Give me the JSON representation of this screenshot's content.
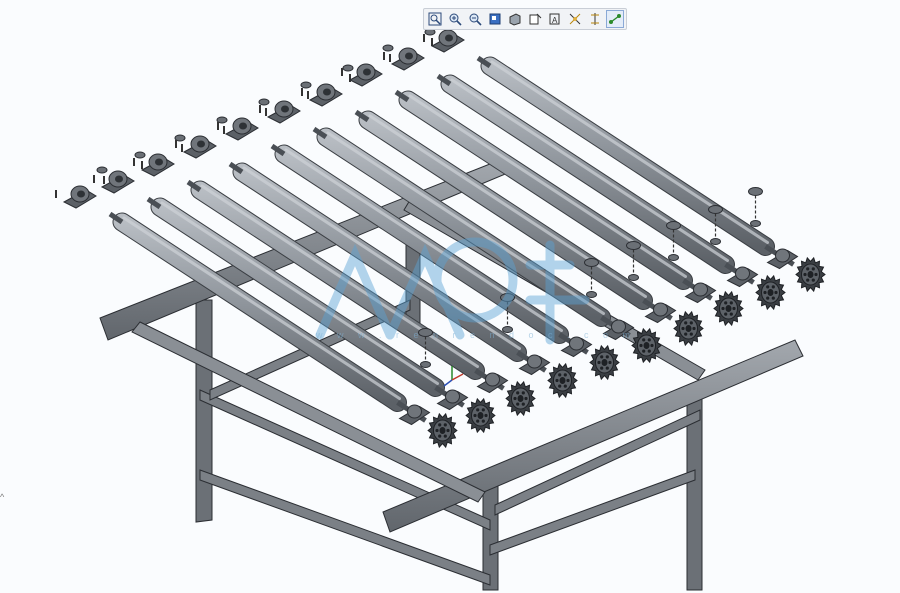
{
  "toolbar": {
    "buttons": [
      {
        "name": "zoom-fit-button",
        "icon": "zoom-fit-icon"
      },
      {
        "name": "zoom-in-button",
        "icon": "zoom-in-icon"
      },
      {
        "name": "zoom-out-button",
        "icon": "zoom-out-icon"
      },
      {
        "name": "repaint-button",
        "icon": "repaint-icon"
      },
      {
        "name": "display-style-button",
        "icon": "display-style-icon"
      },
      {
        "name": "saved-views-button",
        "icon": "saved-views-icon"
      },
      {
        "name": "datum-display-button",
        "icon": "datum-display-icon"
      },
      {
        "name": "annotation-display-button",
        "icon": "annotation-display-icon"
      },
      {
        "name": "spin-center-button",
        "icon": "spin-center-icon"
      },
      {
        "name": "view-manager-button",
        "icon": "view-manager-icon"
      }
    ]
  },
  "viewport": {
    "background": "#fafcfe",
    "part_color": "#8e949b",
    "part_dark": "#4a4f55",
    "outline_color": "#2b2e33",
    "watermark_color": "#5aa3d6",
    "model": "roller-conveyor-assembly"
  },
  "watermark": {
    "glyphs": "人人文库",
    "url": "w w w . r e n r e n d o c . c o m"
  },
  "corner_mark": "^"
}
